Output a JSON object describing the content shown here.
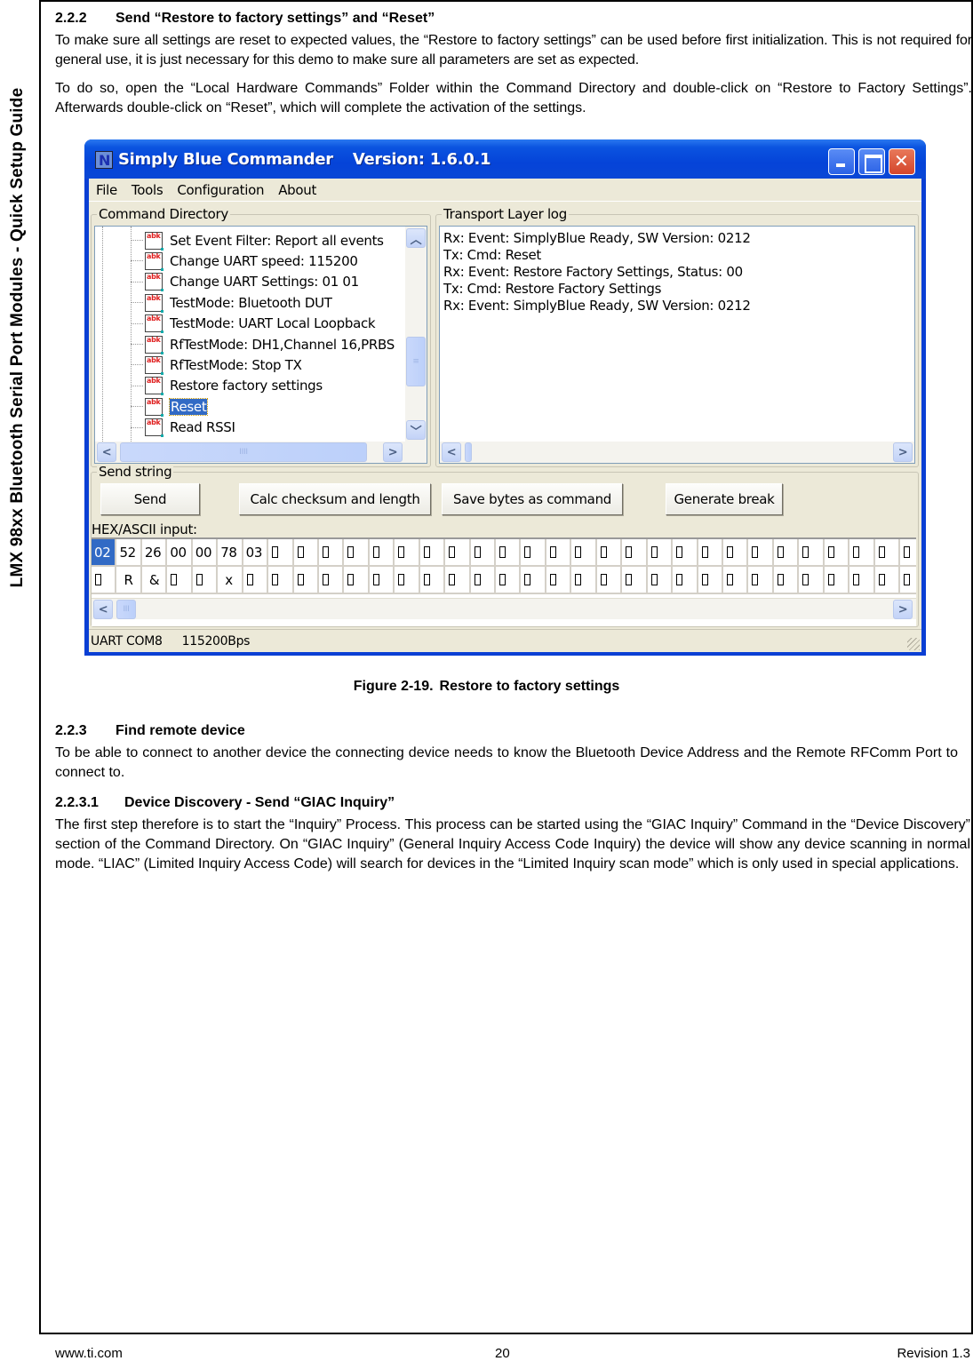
{
  "side_title": "LMX 98xx Bluetooth Serial Port Modules - Quick Setup Guide",
  "sections": {
    "s222": {
      "number": "2.2.2",
      "title": "Send “Restore to factory settings” and “Reset”",
      "paragraphs": [
        "To make sure all settings are reset to expected values, the “Restore to factory settings” can be used before first initialization. This is not required for general use, it is just necessary for this demo to make sure all parameters are set as expected.",
        "To do so, open the “Local Hardware Commands” Folder within the Command Directory and double-click on “Restore to Factory Settings”. Afterwards double-click on “Reset”, which will complete the activation of the settings."
      ]
    },
    "s223": {
      "number": "2.2.3",
      "title": "Find remote device",
      "paragraphs": [
        "To be able to connect to another device the connecting device needs to know the Bluetooth Device Address and the Remote RFComm Port to connect to."
      ]
    },
    "s2231": {
      "number": "2.2.3.1",
      "title": "Device Discovery - Send “GIAC Inquiry”",
      "paragraphs": [
        "The first step therefore is to start the “Inquiry” Process. This process can be started using the “GIAC Inquiry” Command in the “Device Discovery” section of the Command Directory. On “GIAC Inquiry” (General Inquiry Access Code Inquiry) the device will show any device scanning in normal mode. “LIAC” (Limited Inquiry Access Code) will search for devices in the “Limited Inquiry scan mode” which is only used in special applications."
      ]
    }
  },
  "figure": {
    "caption_label": "Figure 2-19.",
    "caption_text": "Restore to factory settings",
    "window": {
      "app_name": "Simply Blue Commander",
      "version": "Version: 1.6.0.1",
      "icons": {
        "app": "app-logo-icon",
        "minimize": "minimize-icon",
        "maximize": "maximize-icon",
        "close": "close-icon"
      },
      "menu": [
        "File",
        "Tools",
        "Configuration",
        "About"
      ],
      "command_directory": {
        "label": "Command Directory",
        "items": [
          {
            "label": "Set Event Filter: Report all events",
            "selected": false
          },
          {
            "label": "Change UART speed: 115200",
            "selected": false
          },
          {
            "label": "Change UART Settings: 01 01",
            "selected": false
          },
          {
            "label": "TestMode: Bluetooth DUT",
            "selected": false
          },
          {
            "label": "TestMode: UART Local Loopback",
            "selected": false
          },
          {
            "label": "RfTestMode: DH1,Channel 16,PRBS",
            "selected": false
          },
          {
            "label": "RfTestMode: Stop TX",
            "selected": false
          },
          {
            "label": "Restore factory settings",
            "selected": false
          },
          {
            "label": "Reset",
            "selected": true
          },
          {
            "label": "Read RSSI",
            "selected": false
          }
        ]
      },
      "transport_log": {
        "label": "Transport Layer log",
        "lines": [
          "Rx: Event: SimplyBlue Ready, SW Version: 0212",
          "Tx: Cmd: Reset",
          "Rx: Event: Restore Factory Settings, Status: 00",
          "Tx: Cmd: Restore Factory Settings",
          "Rx: Event: SimplyBlue Ready, SW Version: 0212"
        ]
      },
      "send_string": {
        "label": "Send string",
        "buttons": {
          "send": "Send",
          "calc": "Calc checksum and length",
          "save": "Save bytes as command",
          "break": "Generate break"
        },
        "hex_label": "HEX/ASCII input:",
        "hex_row": [
          "02",
          "52",
          "26",
          "00",
          "00",
          "78",
          "03"
        ],
        "ascii_row": [
          "",
          "R",
          "&",
          "",
          "",
          "x",
          ""
        ],
        "total_cells": 33
      },
      "status": {
        "port": "UART COM8",
        "baud": "115200Bps"
      },
      "colors": {
        "titlebar": "#0543d8",
        "selection": "#316ac5",
        "face": "#ece9d8",
        "close": "#d4452b"
      }
    }
  },
  "footer": {
    "site": "www.ti.com",
    "page": "20",
    "revision": "Revision 1.3"
  }
}
